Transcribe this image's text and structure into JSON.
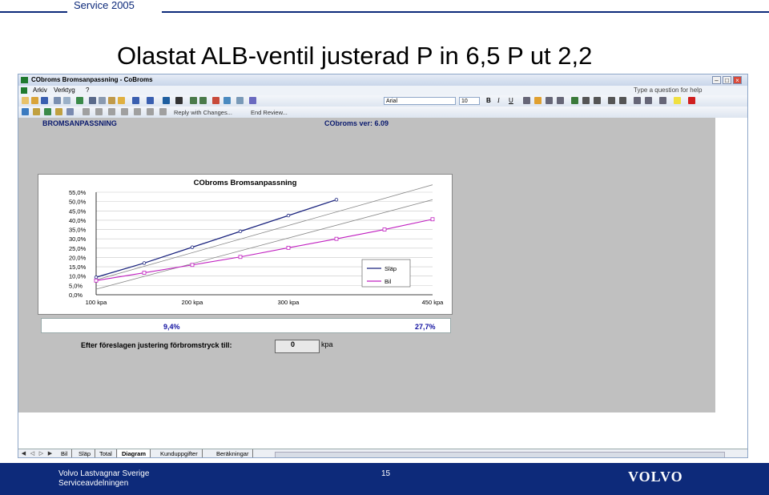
{
  "header": {
    "tab_label": "Service 2005"
  },
  "slide": {
    "title": "Olastat ALB-ventil justerad P in 6,5 P ut 2,2"
  },
  "excel": {
    "window_title": "CObroms Bromsanpassning - CoBroms",
    "menu": [
      "Arkiv",
      "Verktyg",
      "?"
    ],
    "help_placeholder": "Type a question for help",
    "font_name": "Arial",
    "font_size": "10",
    "review_items": [
      "Reply with Changes...",
      "End Review..."
    ],
    "sheet_header_left": "BROMSANPASSNING",
    "sheet_header_right": "CObroms ver: 6.09",
    "result_left": "9,4%",
    "result_right": "27,7%",
    "adjust_label": "Efter föreslagen justering förbromstryck till:",
    "adjust_value": "0",
    "adjust_unit": "kpa",
    "sheet_tabs": [
      "Bil",
      "Släp",
      "Total",
      "Diagram",
      "Kunduppgifter",
      "Beräkningar"
    ],
    "active_tab": "Diagram"
  },
  "chart_data": {
    "type": "line",
    "title": "CObroms Bromsanpassning",
    "x": [
      100,
      150,
      200,
      250,
      300,
      350,
      400,
      450
    ],
    "x_ticks": [
      "100 kpa",
      "200 kpa",
      "300 kpa",
      "450 kpa"
    ],
    "x_tick_values": [
      100,
      200,
      300,
      450
    ],
    "y_ticks": [
      "55,0%",
      "50,0%",
      "45,0%",
      "40,0%",
      "35,0%",
      "30,0%",
      "25,0%",
      "20,0%",
      "15,0%",
      "10,0%",
      "5,0%",
      "0,0%"
    ],
    "ylim": [
      0,
      55
    ],
    "xlim": [
      100,
      450
    ],
    "series": [
      {
        "name": "Släp",
        "color": "#1a237e",
        "x": [
          100,
          150,
          200,
          250,
          300,
          350
        ],
        "values": [
          9.4,
          17.0,
          25.5,
          34.0,
          42.5,
          51.0
        ]
      },
      {
        "name": "Bil",
        "color": "#c020c0",
        "x": [
          100,
          150,
          200,
          250,
          300,
          350,
          400,
          450
        ],
        "values": [
          7.6,
          11.8,
          16.0,
          20.3,
          25.2,
          30.0,
          35.0,
          40.5
        ]
      }
    ],
    "reference_lines": [
      {
        "color": "#888888",
        "values": [
          3.0,
          51.0
        ]
      },
      {
        "color": "#888888",
        "values": [
          8.0,
          59.0
        ]
      }
    ],
    "legend_position": "right"
  },
  "footer": {
    "company": "Volvo Lastvagnar Sverige",
    "department": "Serviceavdelningen",
    "page_number": "15",
    "logo_text": "VOLVO"
  }
}
